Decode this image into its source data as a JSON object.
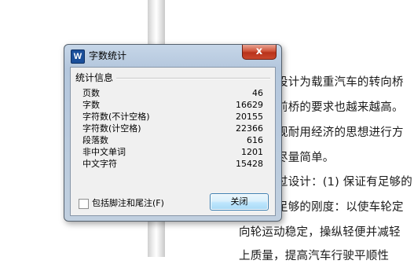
{
  "dialog": {
    "title": "字数统计",
    "app_icon_letter": "W",
    "close_label": "x",
    "group_label": "统计信息",
    "stats": [
      {
        "label": "页数",
        "value": "46"
      },
      {
        "label": "字数",
        "value": "16629"
      },
      {
        "label": "字符数(不计空格)",
        "value": "20155"
      },
      {
        "label": "字符数(计空格)",
        "value": "22366"
      },
      {
        "label": "段落数",
        "value": "616"
      },
      {
        "label": "非中文单词",
        "value": "1201"
      },
      {
        "label": "中文字符",
        "value": "15428"
      }
    ],
    "checkbox_label": "包括脚注和尾注(F)",
    "checkbox_checked": false,
    "close_button_label": "关闭"
  },
  "document": {
    "lines": [
      "设计为载重汽车的转向桥",
      "前桥的要求也越来越高。",
      "观耐用经济的思想进行方",
      "尽量简单。",
      "过设计：(1) 保证有足够的",
      "足够的刚度：以使车轮定",
      "向轮运动稳定，操纵轻便并减轻",
      "上质量，提高汽车行驶平顺性"
    ]
  },
  "colors": {
    "window_frame": "#b4c7dd",
    "close_button": "#c9482d",
    "button_border": "#3c7fb1"
  }
}
